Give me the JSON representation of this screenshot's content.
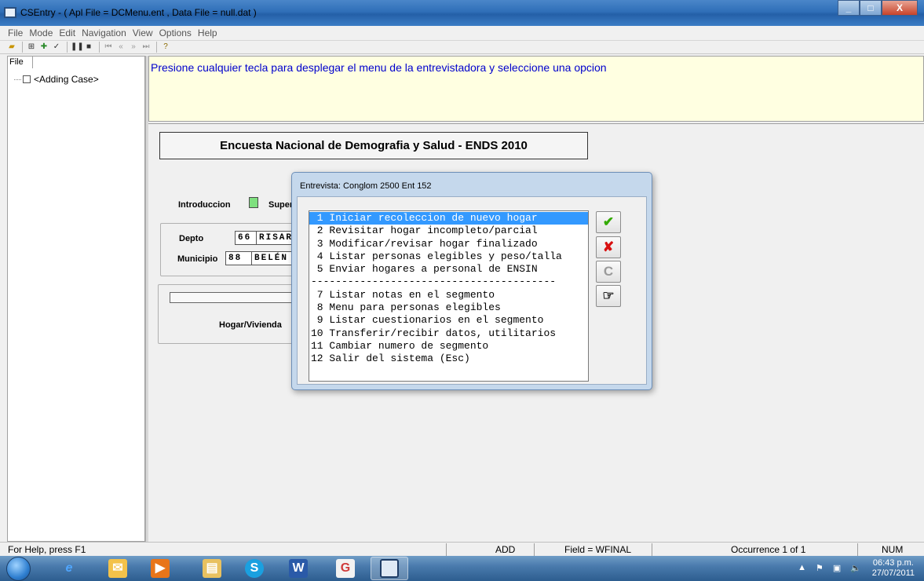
{
  "window": {
    "title": "CSEntry - ( Apl File = DCMenu.ent , Data File = null.dat )",
    "controls": [
      "_",
      "□",
      "X"
    ]
  },
  "menubar": [
    "File",
    "Mode",
    "Edit",
    "Navigation",
    "View",
    "Options",
    "Help"
  ],
  "toolbar_icons": [
    "open-icon",
    "add-case-icon",
    "modify-case-icon",
    "verify-icon",
    "pause-icon",
    "stop-icon",
    "first-icon",
    "prev-icon",
    "next-icon",
    "last-icon",
    "help-icon"
  ],
  "tree": {
    "tab": "File",
    "item": "<Adding Case>"
  },
  "message": "Presione cualquier tecla para desplegar el menu de la entrevistadora y seleccione una opcion",
  "form": {
    "title": "Encuesta Nacional de Demografia y Salud - ENDS 2010",
    "introduccion_label": "Introduccion",
    "super_label": "Super",
    "depto_label": "Depto",
    "depto_code": "66",
    "depto_name": "RISAR",
    "municipio_label": "Municipio",
    "municipio_code": "88",
    "municipio_name": "BELÉN",
    "hogar_label": "Hogar/Vivienda"
  },
  "dialog": {
    "title": "Entrevista: Conglom 2500 Ent 152",
    "items": [
      " 1 Iniciar recoleccion de nuevo hogar",
      " 2 Revisitar hogar incompleto/parcial",
      " 3 Modificar/revisar hogar finalizado",
      " 4 Listar personas elegibles y peso/talla",
      " 5 Enviar hogares a personal de ENSIN",
      "----------------------------------------",
      " 7 Listar notas en el segmento",
      " 8 Menu para personas elegibles",
      " 9 Listar cuestionarios en el segmento",
      "10 Transferir/recibir datos, utilitarios",
      "11 Cambiar numero de segmento",
      "12 Salir del sistema (Esc)"
    ],
    "selected_index": 0,
    "buttons": {
      "ok": "✔",
      "cancel": "✘",
      "refresh": "C",
      "point": "☞"
    },
    "colors": {
      "ok": "#33aa00",
      "cancel": "#d81010",
      "refresh": "#9a9a9a",
      "point": "#222222"
    }
  },
  "statusbar": {
    "help": "For Help, press F1",
    "mode": "ADD",
    "field": "Field = WFINAL",
    "occurrence": "Occurrence 1 of 1",
    "num": "NUM"
  },
  "taskbar": {
    "time": "06:43 p.m.",
    "date": "27/07/2011"
  }
}
